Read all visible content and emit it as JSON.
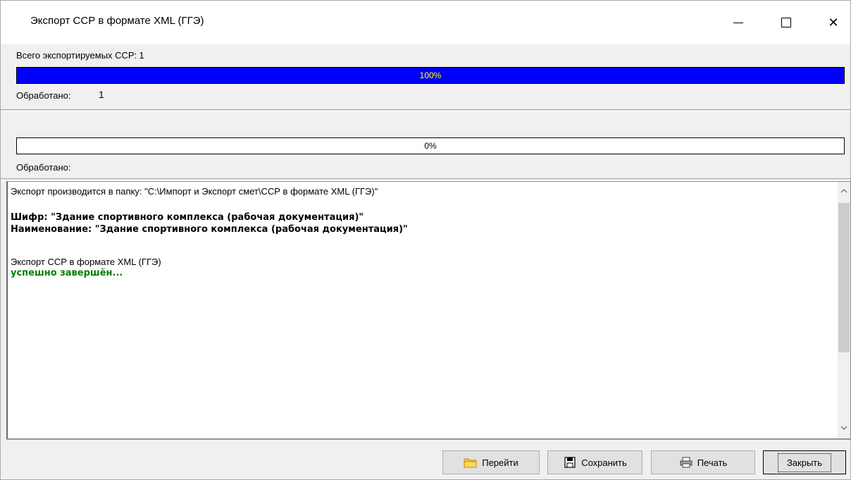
{
  "window": {
    "title": "Экспорт ССР в формате XML (ГГЭ)"
  },
  "section1": {
    "total_label": "Всего экспортируемых ССР: 1",
    "progress_value": 100,
    "progress_text": "100%",
    "processed_label": "Обработано:",
    "processed_value": "1"
  },
  "section2": {
    "progress_value": 0,
    "progress_text": "0%",
    "processed_label": "Обработано:"
  },
  "log": {
    "line1": "Экспорт производится в папку: \"C:\\Импорт и Экспорт смет\\ССР в формате XML (ГГЭ)\"",
    "line2": "Шифр: \"Здание спортивного комплекса (рабочая документация)\"",
    "line3": "Наименование: \"Здание спортивного комплекса (рабочая документация)\"",
    "line4": "Экспорт ССР в формате XML (ГГЭ)",
    "line5": "успешно завершён..."
  },
  "buttons": {
    "goto": "Перейти",
    "save": "Сохранить",
    "print": "Печать",
    "close": "Закрыть"
  },
  "colors": {
    "progress_fill": "#0000ff",
    "success": "#008000"
  }
}
